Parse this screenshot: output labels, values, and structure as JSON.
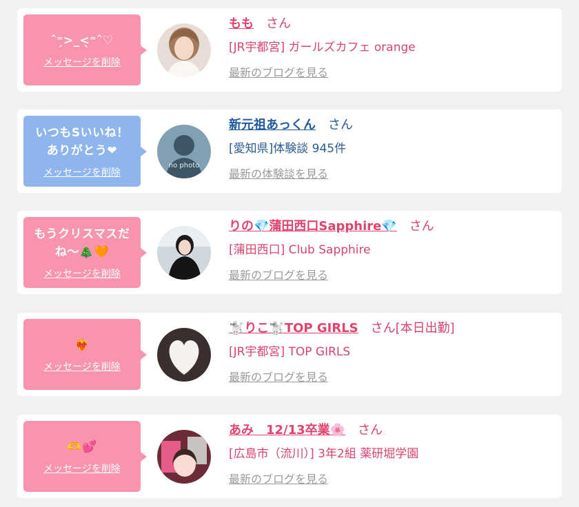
{
  "cards": [
    {
      "message": "ˆ⁼̗>_<̖⁼ˆ♡",
      "delete_label": "メッセージを削除",
      "name": "もも",
      "honorific": "さん",
      "extra": "",
      "shop": "[JR宇都宮] ガールズカフェ orange",
      "more_label": "最新のブログを見る",
      "theme": "pink"
    },
    {
      "message": "いつもSいいね！\nありがとう❤",
      "delete_label": "メッセージを削除",
      "name": "新元祖あっくん",
      "honorific": "さん",
      "extra": "",
      "shop": "[愛知県]体験談 945件",
      "more_label": "最新の体験談を見る",
      "theme": "blue",
      "avatar_text": "no photo"
    },
    {
      "message": "もうクリスマスだ\nね〜🎄🧡",
      "delete_label": "メッセージを削除",
      "name": "りの💎蒲田西口Sapphire💎",
      "honorific": "さん",
      "extra": "",
      "shop": "[蒲田西口] Club Sapphire",
      "more_label": "最新のブログを見る",
      "theme": "pink"
    },
    {
      "message": "❤️‍🔥",
      "delete_label": "メッセージを削除",
      "name": "🐩りこ🐩TOP GIRLS",
      "honorific": "さん",
      "extra": "[本日出勤]",
      "shop": "[JR宇都宮] TOP GIRLS",
      "more_label": "最新のブログを見る",
      "theme": "pink"
    },
    {
      "message": "🫶💕",
      "delete_label": "メッセージを削除",
      "name": "あみ　12/13卒業🌸",
      "honorific": "さん",
      "extra": "",
      "shop": "[広島市（流川）] 3年2組 薬研堀学園",
      "more_label": "最新のブログを見る",
      "theme": "pink"
    }
  ],
  "colors": {
    "pink_bubble": "#f894ad",
    "blue_bubble": "#8fb5ef",
    "pink_text": "#e2426e",
    "blue_text": "#1f5aa0",
    "muted_link": "#9a9a9a",
    "page_bg": "#f1f1f3"
  }
}
